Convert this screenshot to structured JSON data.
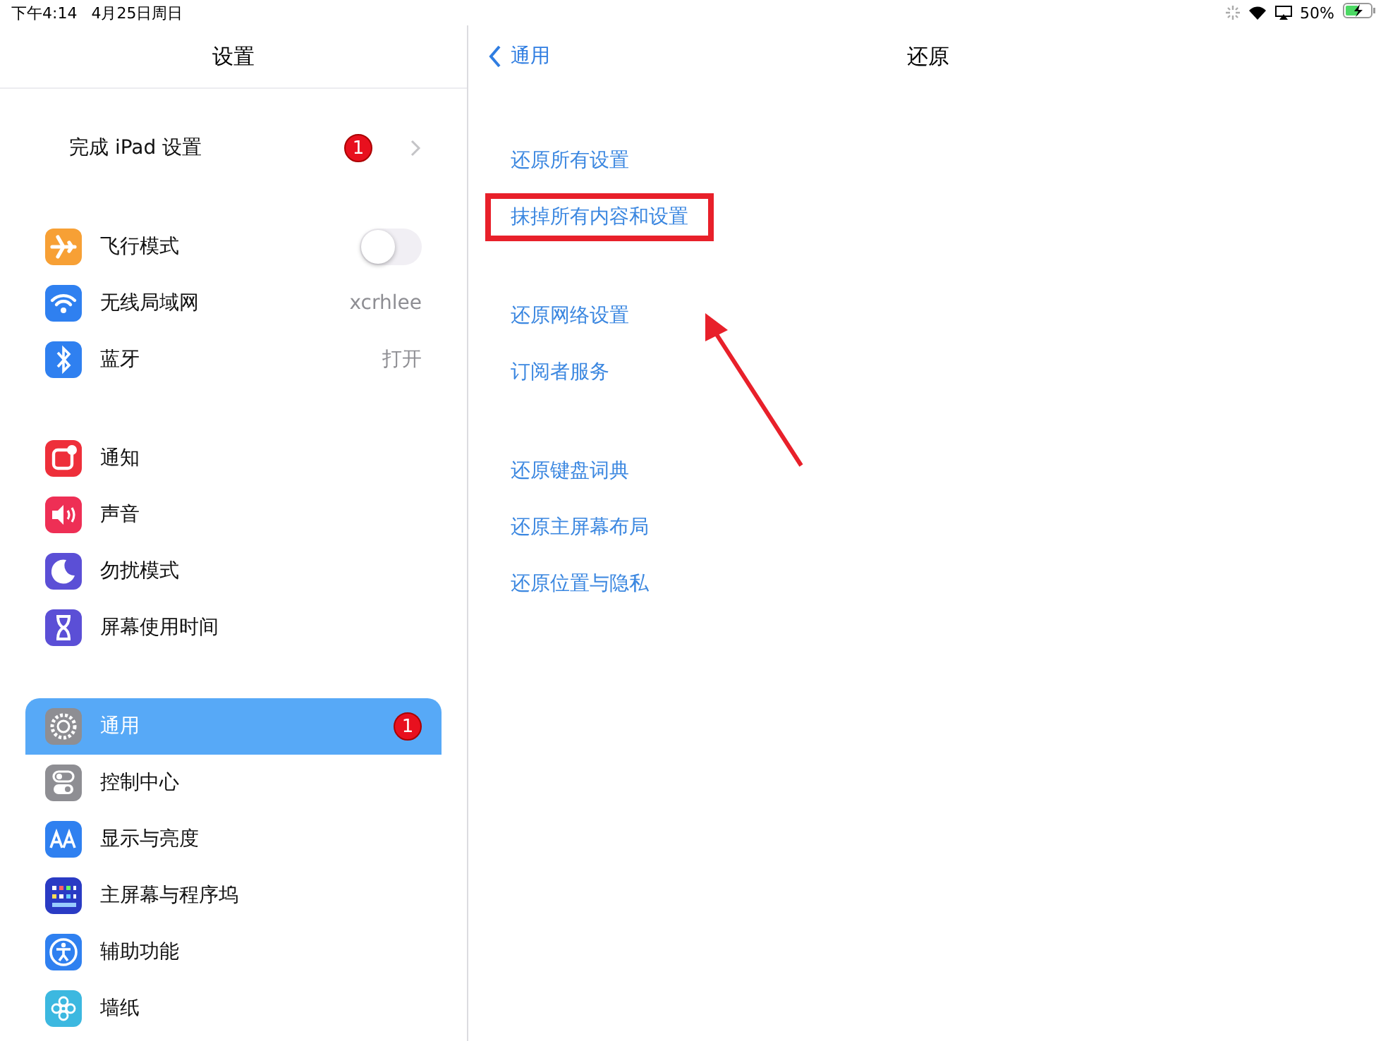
{
  "status_bar": {
    "time": "下午4:14",
    "date": "4月25日周日",
    "battery": "50%",
    "charging": true
  },
  "sidebar": {
    "title": "设置",
    "groups": [
      [
        {
          "kind": "setup",
          "label": "完成 iPad 设置",
          "badge": "1",
          "selected": false
        }
      ],
      [
        {
          "kind": "toggle",
          "label": "飞行模式",
          "on": false,
          "color": "#f7a035",
          "selected": false
        },
        {
          "kind": "value",
          "label": "无线局域网",
          "value": "xcrhlee",
          "color": "#2f80f0",
          "selected": false
        },
        {
          "kind": "value",
          "label": "蓝牙",
          "value": "打开",
          "color": "#2f80f0",
          "selected": false
        }
      ],
      [
        {
          "kind": "link",
          "label": "通知",
          "color": "#ee2f3a",
          "selected": false
        },
        {
          "kind": "link",
          "label": "声音",
          "color": "#ee2f55",
          "selected": false
        },
        {
          "kind": "link",
          "label": "勿扰模式",
          "color": "#5b4fd6",
          "selected": false
        },
        {
          "kind": "link",
          "label": "屏幕使用时间",
          "color": "#5b4fd6",
          "selected": false
        }
      ],
      [
        {
          "kind": "link",
          "label": "通用",
          "badge": "1",
          "color": "#8e8e93",
          "selected": true
        },
        {
          "kind": "link",
          "label": "控制中心",
          "color": "#8e8e93",
          "selected": false
        },
        {
          "kind": "link",
          "label": "显示与亮度",
          "color": "#2f80f0",
          "selected": false
        },
        {
          "kind": "link",
          "label": "主屏幕与程序坞",
          "color": "#2a3bc4",
          "selected": false
        },
        {
          "kind": "link",
          "label": "辅助功能",
          "color": "#2f80f0",
          "selected": false
        },
        {
          "kind": "link",
          "label": "墙纸",
          "color": "#3cb8e0",
          "selected": false
        }
      ]
    ]
  },
  "detail": {
    "back": "通用",
    "title": "还原",
    "groups": [
      [
        {
          "label": "还原所有设置",
          "highlighted": false
        },
        {
          "label": "抹掉所有内容和设置",
          "highlighted": true
        }
      ],
      [
        {
          "label": "还原网络设置",
          "highlighted": false
        },
        {
          "label": "订阅者服务",
          "highlighted": false
        }
      ],
      [
        {
          "label": "还原键盘词典",
          "highlighted": false
        },
        {
          "label": "还原主屏幕布局",
          "highlighted": false
        },
        {
          "label": "还原位置与隐私",
          "highlighted": false
        }
      ]
    ]
  }
}
